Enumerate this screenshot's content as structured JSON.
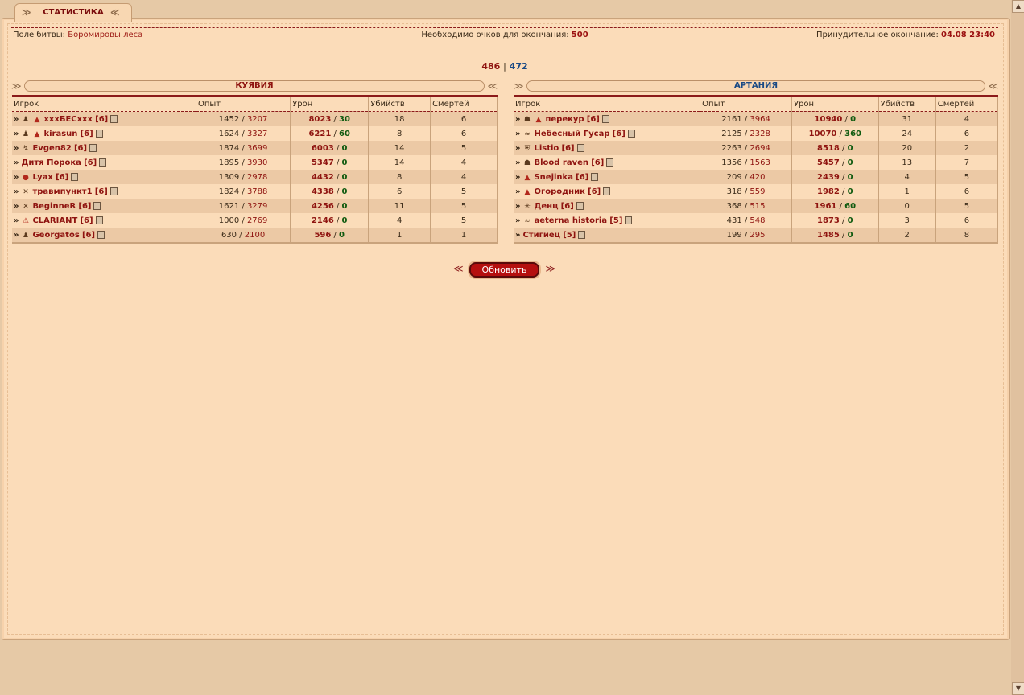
{
  "tab": {
    "label": "СТАТИСТИКА"
  },
  "info": {
    "battlefield_label": "Поле битвы:",
    "battlefield_value": "Боромировы леса",
    "points_label": "Необходимо очков для окончания:",
    "points_value": "500",
    "forced_end_label": "Принудительное окончание:",
    "forced_end_value": "04.08 23:40"
  },
  "score": {
    "left": "486",
    "sep": "|",
    "right": "472"
  },
  "teams": [
    {
      "name": "КУЯВИЯ",
      "color": "#8f1410",
      "headers": [
        "Игрок",
        "Опыт",
        "Урон",
        "Убийств",
        "Смертей"
      ],
      "rows": [
        {
          "icons": [
            "penguin-icon",
            "clan-red-icon"
          ],
          "name": "xxxБЕСxxx",
          "level": "[6]",
          "exp_cur": "1452",
          "exp_max": "3207",
          "dmg": "8023",
          "heal": "30",
          "kills": "18",
          "deaths": "6"
        },
        {
          "icons": [
            "penguin-icon",
            "clan-red-icon"
          ],
          "name": "kirasun",
          "level": "[6]",
          "exp_cur": "1624",
          "exp_max": "3327",
          "dmg": "6221",
          "heal": "60",
          "kills": "8",
          "deaths": "6"
        },
        {
          "icons": [
            "dragon-icon"
          ],
          "name": "Evgen82",
          "level": "[6]",
          "exp_cur": "1874",
          "exp_max": "3699",
          "dmg": "6003",
          "heal": "0",
          "kills": "14",
          "deaths": "5"
        },
        {
          "icons": [],
          "name": "Дитя Порока",
          "level": "[6]",
          "exp_cur": "1895",
          "exp_max": "3930",
          "dmg": "5347",
          "heal": "0",
          "kills": "14",
          "deaths": "4"
        },
        {
          "icons": [
            "bag-icon"
          ],
          "name": "Lyax",
          "level": "[6]",
          "exp_cur": "1309",
          "exp_max": "2978",
          "dmg": "4432",
          "heal": "0",
          "kills": "8",
          "deaths": "4"
        },
        {
          "icons": [
            "crossed-axes-icon"
          ],
          "name": "травмпункт1",
          "level": "[6]",
          "exp_cur": "1824",
          "exp_max": "3788",
          "dmg": "4338",
          "heal": "0",
          "kills": "6",
          "deaths": "5"
        },
        {
          "icons": [
            "crossed-axes-icon"
          ],
          "name": "BeginneR",
          "level": "[6]",
          "exp_cur": "1621",
          "exp_max": "3279",
          "dmg": "4256",
          "heal": "0",
          "kills": "11",
          "deaths": "5"
        },
        {
          "icons": [
            "warning-icon"
          ],
          "name": "CLARIANT",
          "level": "[6]",
          "exp_cur": "1000",
          "exp_max": "2769",
          "dmg": "2146",
          "heal": "0",
          "kills": "4",
          "deaths": "5"
        },
        {
          "icons": [
            "penguin-icon"
          ],
          "name": "Georgatos",
          "level": "[6]",
          "exp_cur": "630",
          "exp_max": "2100",
          "dmg": "596",
          "heal": "0",
          "kills": "1",
          "deaths": "1"
        }
      ]
    },
    {
      "name": "АРТАНИЯ",
      "color": "#1a4a85",
      "headers": [
        "Игрок",
        "Опыт",
        "Урон",
        "Убийств",
        "Смертей"
      ],
      "rows": [
        {
          "icons": [
            "skull-icon",
            "clan-red-icon"
          ],
          "name": "перекур",
          "level": "[6]",
          "exp_cur": "2161",
          "exp_max": "3964",
          "dmg": "10940",
          "heal": "0",
          "kills": "31",
          "deaths": "4"
        },
        {
          "icons": [
            "wave-icon"
          ],
          "name": "Небесный Гусар",
          "level": "[6]",
          "exp_cur": "2125",
          "exp_max": "2328",
          "dmg": "10070",
          "heal": "360",
          "kills": "24",
          "deaths": "6"
        },
        {
          "icons": [
            "shield-icon"
          ],
          "name": "Listio",
          "level": "[6]",
          "exp_cur": "2263",
          "exp_max": "2694",
          "dmg": "8518",
          "heal": "0",
          "kills": "20",
          "deaths": "2"
        },
        {
          "icons": [
            "skull-icon"
          ],
          "name": "Blood raven",
          "level": "[6]",
          "exp_cur": "1356",
          "exp_max": "1563",
          "dmg": "5457",
          "heal": "0",
          "kills": "13",
          "deaths": "7"
        },
        {
          "icons": [
            "clan-red-icon"
          ],
          "name": "Snejinka",
          "level": "[6]",
          "exp_cur": "209",
          "exp_max": "420",
          "dmg": "2439",
          "heal": "0",
          "kills": "4",
          "deaths": "5"
        },
        {
          "icons": [
            "clan-red-icon"
          ],
          "name": "Огородник",
          "level": "[6]",
          "exp_cur": "318",
          "exp_max": "559",
          "dmg": "1982",
          "heal": "0",
          "kills": "1",
          "deaths": "6"
        },
        {
          "icons": [
            "snowflake-icon"
          ],
          "name": "Денц",
          "level": "[6]",
          "exp_cur": "368",
          "exp_max": "515",
          "dmg": "1961",
          "heal": "60",
          "kills": "0",
          "deaths": "5"
        },
        {
          "icons": [
            "wave-icon"
          ],
          "name": "aeterna historia",
          "level": "[5]",
          "exp_cur": "431",
          "exp_max": "548",
          "dmg": "1873",
          "heal": "0",
          "kills": "3",
          "deaths": "6"
        },
        {
          "icons": [],
          "name": "Стигиец",
          "level": "[5]",
          "exp_cur": "199",
          "exp_max": "295",
          "dmg": "1485",
          "heal": "0",
          "kills": "2",
          "deaths": "8"
        }
      ]
    }
  ],
  "refresh": {
    "label": "Обновить"
  }
}
